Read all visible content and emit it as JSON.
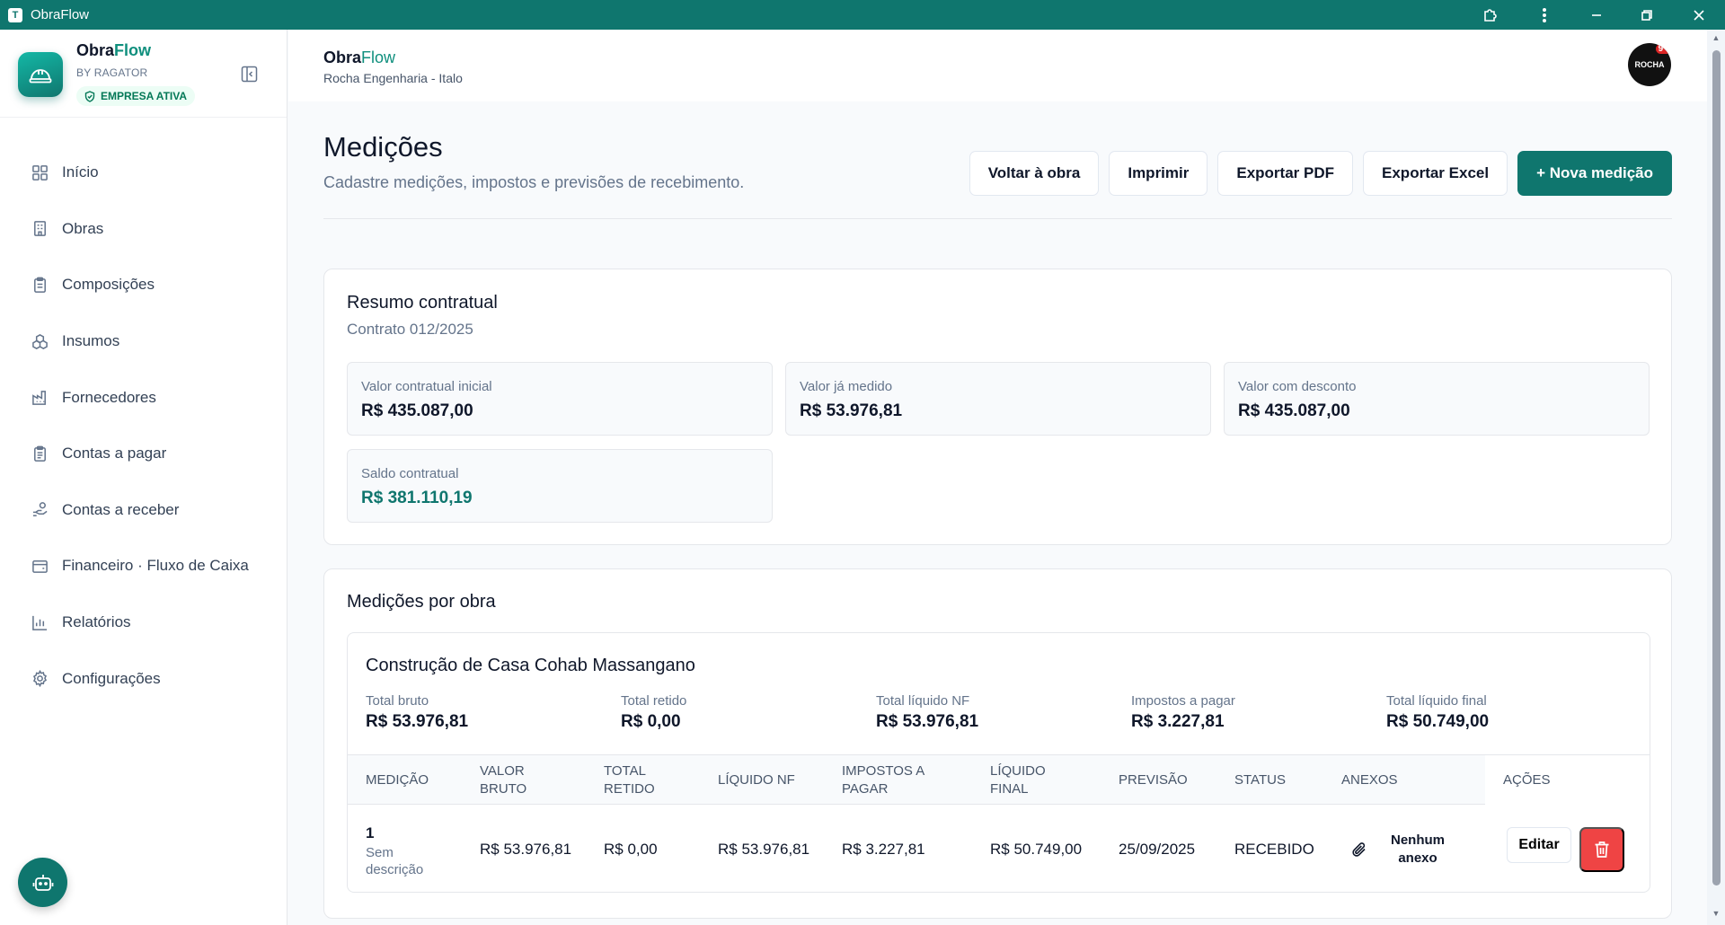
{
  "window": {
    "title": "ObraFlow",
    "app_icon_glyph": "T"
  },
  "brand": {
    "name_a": "Obra",
    "name_b": "Flow",
    "by": "BY RAGATOR",
    "badge": "EMPRESA ATIVA"
  },
  "nav": {
    "items": [
      {
        "label": "Início",
        "icon": "grid-icon"
      },
      {
        "label": "Obras",
        "icon": "building-icon"
      },
      {
        "label": "Composições",
        "icon": "clipboard-icon"
      },
      {
        "label": "Insumos",
        "icon": "boxes-icon"
      },
      {
        "label": "Fornecedores",
        "icon": "factory-icon"
      },
      {
        "label": "Contas a pagar",
        "icon": "clipboard-list-icon"
      },
      {
        "label": "Contas a receber",
        "icon": "hand-coins-icon"
      },
      {
        "label": "Financeiro · Fluxo de Caixa",
        "icon": "wallet-icon"
      },
      {
        "label": "Relatórios",
        "icon": "bar-chart-icon"
      },
      {
        "label": "Configurações",
        "icon": "gear-icon"
      }
    ]
  },
  "topbar": {
    "title_a": "Obra",
    "title_b": "Flow",
    "subtitle": "Rocha Engenharia - Italo",
    "avatar_text": "ROCHA",
    "avatar_badge": "9+"
  },
  "page": {
    "title": "Medições",
    "subtitle": "Cadastre medições, impostos e previsões de recebimento.",
    "actions": {
      "back": "Voltar à obra",
      "print": "Imprimir",
      "pdf": "Exportar PDF",
      "excel": "Exportar Excel",
      "new": "+ Nova medição"
    }
  },
  "summary": {
    "title": "Resumo contratual",
    "contract": "Contrato 012/2025",
    "stats": [
      {
        "label": "Valor contratual inicial",
        "value": "R$ 435.087,00"
      },
      {
        "label": "Valor já medido",
        "value": "R$ 53.976,81"
      },
      {
        "label": "Valor com desconto",
        "value": "R$ 435.087,00"
      },
      {
        "label": "Saldo contratual",
        "value": "R$ 381.110,19"
      }
    ]
  },
  "by_work": {
    "title": "Medições por obra",
    "work": {
      "name": "Construção de Casa Cohab Massangano",
      "totals": [
        {
          "label": "Total bruto",
          "value": "R$ 53.976,81"
        },
        {
          "label": "Total retido",
          "value": "R$ 0,00"
        },
        {
          "label": "Total líquido NF",
          "value": "R$ 53.976,81"
        },
        {
          "label": "Impostos a pagar",
          "value": "R$ 3.227,81"
        },
        {
          "label": "Total líquido final",
          "value": "R$ 50.749,00"
        }
      ],
      "columns": [
        "MEDIÇÃO",
        "VALOR BRUTO",
        "TOTAL RETIDO",
        "LÍQUIDO NF",
        "IMPOSTOS A PAGAR",
        "LÍQUIDO FINAL",
        "PREVISÃO",
        "STATUS",
        "ANEXOS",
        "AÇÕES"
      ],
      "row": {
        "number": "1",
        "description": "Sem descrição",
        "gross": "R$ 53.976,81",
        "retained": "R$ 0,00",
        "net_nf": "R$ 53.976,81",
        "taxes": "R$ 3.227,81",
        "net_final": "R$ 50.749,00",
        "forecast": "25/09/2025",
        "status": "RECEBIDO",
        "attachments": "Nenhum anexo",
        "edit_label": "Editar"
      }
    }
  }
}
